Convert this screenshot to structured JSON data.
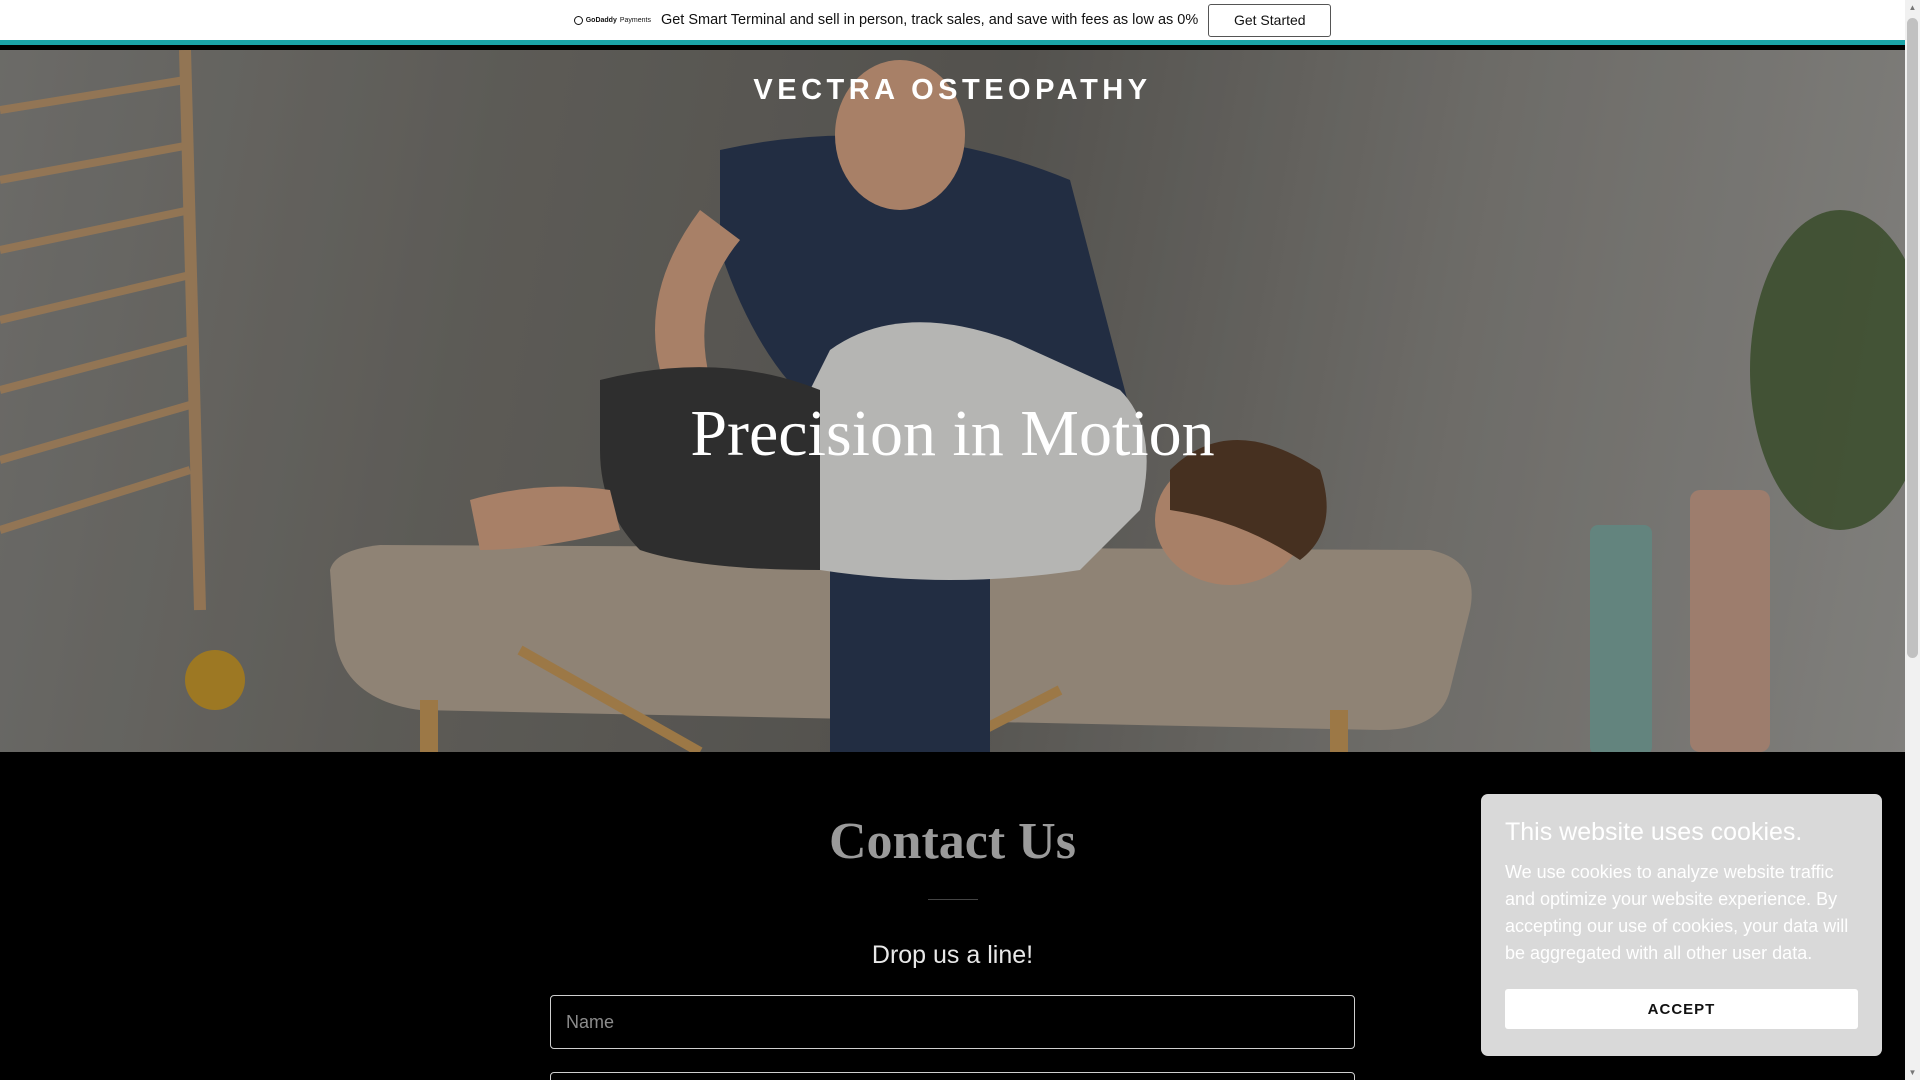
{
  "promo": {
    "logo_brand": "GoDaddy",
    "logo_suffix": "Payments",
    "text": "Get Smart Terminal and sell in person, track sales, and save with fees as low as 0%",
    "button_label": "Get Started",
    "accent_color": "#1ba4a8"
  },
  "hero": {
    "site_title": "VECTRA OSTEOPATHY",
    "heading": "Precision in Motion"
  },
  "contact": {
    "title": "Contact Us",
    "subtitle": "Drop us a line!",
    "name_placeholder": "Name",
    "email_placeholder": ""
  },
  "cookie": {
    "title": "This website uses cookies.",
    "body": "We use cookies to analyze website traffic and optimize your website experience. By accepting our use of cookies, your data will be aggregated with all other user data.",
    "accept_label": "ACCEPT"
  },
  "scrollbar": {
    "up_arrow": "▲",
    "down_arrow": "▼"
  }
}
